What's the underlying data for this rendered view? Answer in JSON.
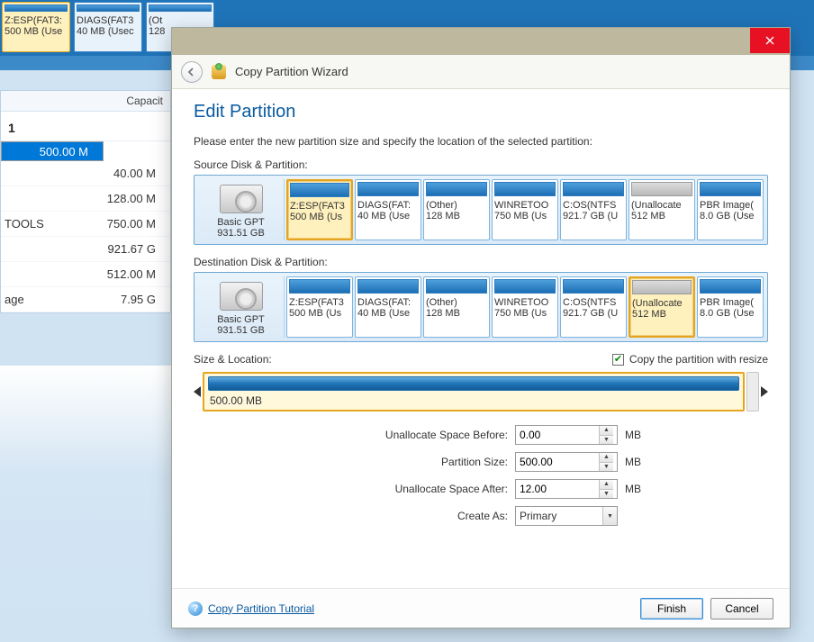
{
  "bg_tiles": [
    {
      "l1": "Z:ESP(FAT3:",
      "l2": "500 MB (Use",
      "selected": true
    },
    {
      "l1": "DIAGS(FAT3",
      "l2": "40 MB (Usec",
      "selected": false
    },
    {
      "l1": "(Ot",
      "l2": "128",
      "selected": false
    }
  ],
  "bg_table": {
    "header": "Capacit",
    "disk_label": "1",
    "rows": [
      {
        "label": "",
        "cap": "500.00 M",
        "selected": true
      },
      {
        "label": "",
        "cap": "40.00 M",
        "selected": false
      },
      {
        "label": "",
        "cap": "128.00 M",
        "selected": false
      },
      {
        "label": "TOOLS",
        "cap": "750.00 M",
        "selected": false
      },
      {
        "label": "",
        "cap": "921.67 G",
        "selected": false
      },
      {
        "label": "",
        "cap": "512.00 M",
        "selected": false
      },
      {
        "label": "age",
        "cap": "7.95 G",
        "selected": false
      }
    ]
  },
  "dialog": {
    "wizard_title": "Copy Partition Wizard",
    "page_title": "Edit Partition",
    "instruction": "Please enter the new partition size and specify the location of the selected partition:",
    "source_label": "Source Disk & Partition:",
    "dest_label": "Destination Disk & Partition:",
    "disk": {
      "name": "Basic GPT",
      "size": "931.51 GB"
    },
    "source_parts": [
      {
        "l1": "Z:ESP(FAT3",
        "l2": "500 MB (Us",
        "selected": true,
        "unalloc": false
      },
      {
        "l1": "DIAGS(FAT:",
        "l2": "40 MB (Use",
        "selected": false,
        "unalloc": false
      },
      {
        "l1": "(Other)",
        "l2": "128 MB",
        "selected": false,
        "unalloc": false
      },
      {
        "l1": "WINRETOO",
        "l2": "750 MB (Us",
        "selected": false,
        "unalloc": false
      },
      {
        "l1": "C:OS(NTFS",
        "l2": "921.7 GB (U",
        "selected": false,
        "unalloc": false
      },
      {
        "l1": "(Unallocate",
        "l2": "512 MB",
        "selected": false,
        "unalloc": true
      },
      {
        "l1": "PBR Image(",
        "l2": "8.0 GB (Use",
        "selected": false,
        "unalloc": false
      }
    ],
    "dest_parts": [
      {
        "l1": "Z:ESP(FAT3",
        "l2": "500 MB (Us",
        "selected": false,
        "unalloc": false
      },
      {
        "l1": "DIAGS(FAT:",
        "l2": "40 MB (Use",
        "selected": false,
        "unalloc": false
      },
      {
        "l1": "(Other)",
        "l2": "128 MB",
        "selected": false,
        "unalloc": false
      },
      {
        "l1": "WINRETOO",
        "l2": "750 MB (Us",
        "selected": false,
        "unalloc": false
      },
      {
        "l1": "C:OS(NTFS",
        "l2": "921.7 GB (U",
        "selected": false,
        "unalloc": false
      },
      {
        "l1": "(Unallocate",
        "l2": "512 MB",
        "selected": true,
        "unalloc": true
      },
      {
        "l1": "PBR Image(",
        "l2": "8.0 GB (Use",
        "selected": false,
        "unalloc": false
      }
    ],
    "sizeloc_label": "Size & Location:",
    "resize_chk": "Copy the partition with resize",
    "resize_checked": true,
    "slider_value": "500.00 MB",
    "fields": {
      "before_label": "Unallocate Space Before:",
      "before_value": "0.00",
      "size_label": "Partition Size:",
      "size_value": "500.00",
      "after_label": "Unallocate Space After:",
      "after_value": "12.00",
      "unit": "MB",
      "createas_label": "Create As:",
      "createas_value": "Primary"
    },
    "tutorial": "Copy Partition Tutorial",
    "buttons": {
      "finish": "Finish",
      "cancel": "Cancel"
    }
  }
}
